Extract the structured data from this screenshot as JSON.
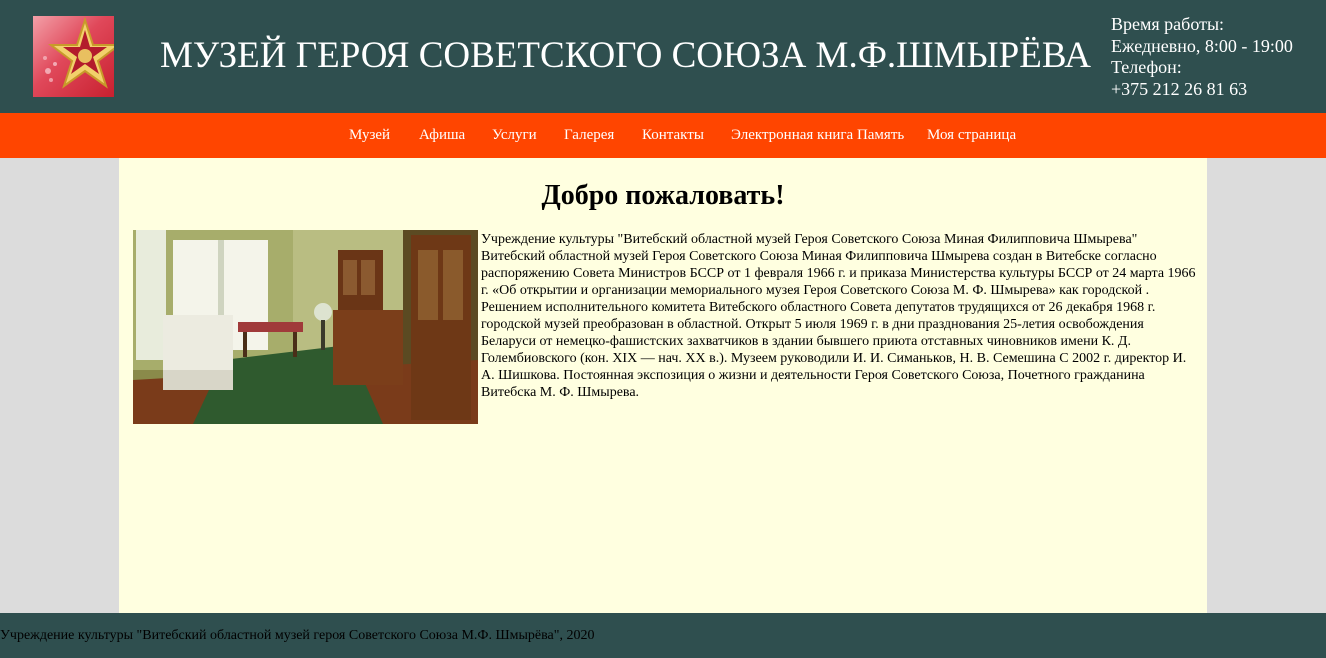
{
  "header": {
    "title": "МУЗЕЙ ГЕРОЯ СОВЕТСКОГО СОЮЗА М.Ф.ШМЫРЁВА",
    "hours_label": "Время работы:",
    "hours_value": "Ежедневно, 8:00 - 19:00",
    "phone_label": "Телефон:",
    "phone_value": "+375 212 26 81 63"
  },
  "nav": {
    "items": [
      "Музей",
      "Афиша",
      "Услуги",
      "Галерея",
      "Контакты",
      "Электронная книга Память",
      "Моя страница"
    ]
  },
  "main": {
    "heading": "Добро пожаловать!",
    "paragraph": "Учреждение культуры \"Витебский областной музей Героя Советского Союза Миная Филипповича Шмырева\" Витебский областной музей Героя Советского Союза Миная Филипповича Шмырева создан в Витебске согласно распоряжению Совета Министров БССР от 1 февраля 1966 г. и приказа Министерства культуры БССР от 24 марта 1966 г. «Об открытии и организации мемориального музея Героя Советского Союза М. Ф. Шмырева» как городской . Решением исполнительного комитета Витебского областного Совета депутатов трудящихся от 26 декабря 1968 г. городской музей преобразован в областной. Открыт 5 июля 1969 г. в дни празднования 25-летия освобождения Беларуси от немецко-фашистских захватчиков в здании бывшего приюта отставных чиновников имени К. Д. Голембиовского (кон. XIX — нач. XX в.). Музеем руководили И. И. Симаньков, Н. В. Семешина С 2002 г. директор И. А. Шишкова. Постоянная экспозиция о жизни и деятельности Героя Советского Союза, Почетного гражданина Витебска М. Ф. Шмырева."
  },
  "footer": {
    "text": "Учреждение культуры \"Витебский областной музей героя Советского Союза М.Ф. Шмырёва\", 2020"
  },
  "colors": {
    "header_bg": "#2f4f4f",
    "nav_bg": "#ff4500",
    "content_bg": "#ffffe0",
    "page_bg": "#dcdcdc"
  },
  "icons": {
    "logo": "gold-star-logo"
  }
}
